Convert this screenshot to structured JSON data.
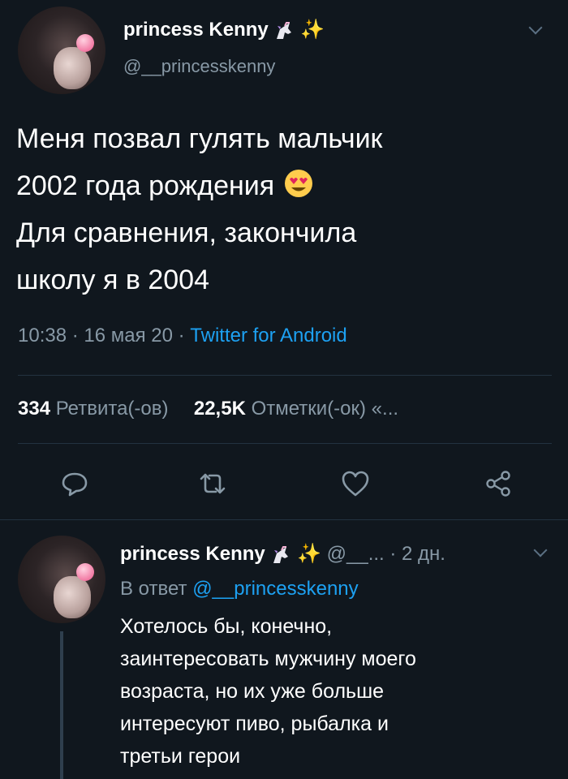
{
  "tweet": {
    "display_name": "princess Kenny",
    "name_emoji": "✨",
    "handle": "@__princesskenny",
    "text_lines": [
      "Меня позвал гулять мальчик",
      "2002 года рождения",
      "Для сравнения, закончила",
      "школу я в 2004"
    ],
    "meta": {
      "time": "10:38",
      "date": "16 мая 20",
      "separator": " · ",
      "source": "Twitter for Android"
    },
    "stats": {
      "retweets_count": "334",
      "retweets_label": "Ретвита(-ов)",
      "likes_count": "22,5K",
      "likes_label": "Отметки(-ок) «..."
    },
    "actions": [
      "reply-icon",
      "retweet-icon",
      "like-icon",
      "share-icon"
    ]
  },
  "reply": {
    "display_name": "princess Kenny",
    "name_emoji": "✨",
    "handle_short": "@__...",
    "age": "· 2 дн.",
    "reply_to_prefix": "В ответ",
    "reply_to_handle": "@__princesskenny",
    "text_lines": [
      "Хотелось бы, конечно,",
      "заинтересовать мужчину моего",
      "возраста, но их уже больше",
      "интересуют пиво, рыбалка и",
      "третьи герои"
    ]
  },
  "colors": {
    "background": "#10171e",
    "muted": "#8899a6",
    "link": "#1da1f2",
    "divider": "#233240"
  }
}
